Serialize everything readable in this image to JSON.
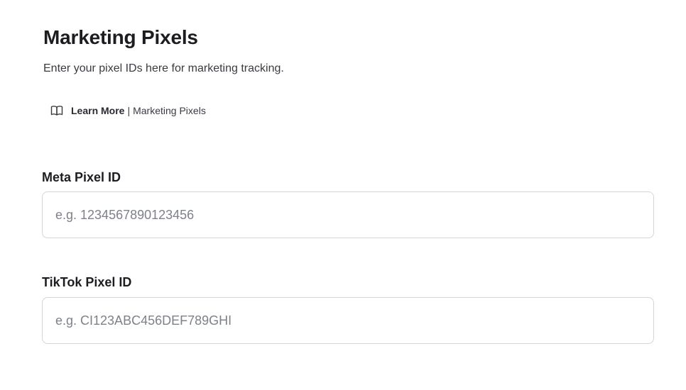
{
  "header": {
    "title": "Marketing Pixels",
    "subtitle": "Enter your pixel IDs here for marketing tracking."
  },
  "learn_more": {
    "icon": "book-open-icon",
    "label": "Learn More",
    "separator": "|",
    "topic": "Marketing Pixels"
  },
  "fields": {
    "meta": {
      "label": "Meta Pixel ID",
      "value": "",
      "placeholder": "e.g. 1234567890123456"
    },
    "tiktok": {
      "label": "TikTok Pixel ID",
      "value": "",
      "placeholder": "e.g. CI123ABC456DEF789GHI"
    }
  }
}
